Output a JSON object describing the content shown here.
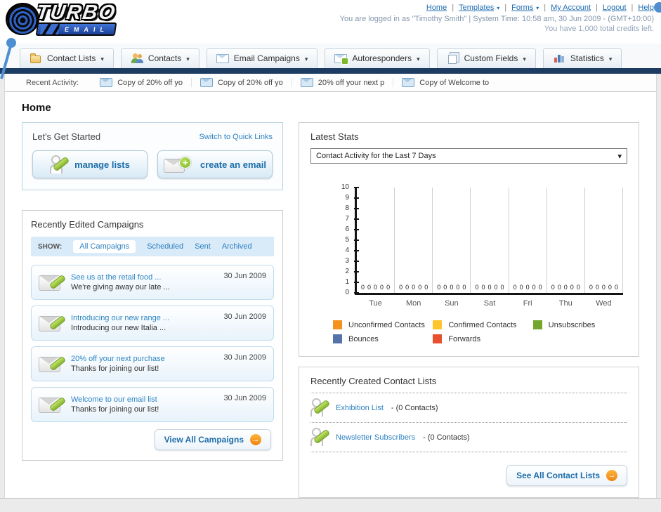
{
  "header": {
    "logo": {
      "line1": "TURBO",
      "line2": "EMAIL"
    },
    "nav_links": [
      {
        "label": "Home"
      },
      {
        "label": "Templates",
        "dropdown": true
      },
      {
        "label": "Forms",
        "dropdown": true
      },
      {
        "label": "My Account"
      },
      {
        "label": "Logout"
      },
      {
        "label": "Help"
      }
    ],
    "login_info": "You are logged in as \"Timothy Smith\" | System Time: 10:58 am, 30 Jun 2009 - (GMT+10:00)",
    "credits_info": "You have 1,000 total credits left."
  },
  "nav_tabs": [
    {
      "label": "Contact Lists"
    },
    {
      "label": "Contacts"
    },
    {
      "label": "Email Campaigns"
    },
    {
      "label": "Autoresponders"
    },
    {
      "label": "Custom Fields"
    },
    {
      "label": "Statistics"
    }
  ],
  "recent_activity": {
    "label": "Recent Activity:",
    "items": [
      "Copy of 20% off yo",
      "Copy of 20% off yo",
      "20% off your next p",
      "Copy of Welcome to"
    ]
  },
  "page_title": "Home",
  "get_started": {
    "title": "Let's Get Started",
    "switch_link": "Switch to Quick Links",
    "buttons": [
      {
        "label": "manage lists"
      },
      {
        "label": "create an email"
      }
    ]
  },
  "campaigns": {
    "title": "Recently Edited Campaigns",
    "show_label": "SHOW:",
    "filters": [
      {
        "label": "All Campaigns",
        "active": true
      },
      {
        "label": "Scheduled"
      },
      {
        "label": "Sent"
      },
      {
        "label": "Archived"
      }
    ],
    "items": [
      {
        "title": "See us at the retail food ...",
        "subtitle": "We're giving away our late ...",
        "date": "30 Jun 2009"
      },
      {
        "title": "Introducing our new range ...",
        "subtitle": "Introducing our new Italia ...",
        "date": "30 Jun 2009"
      },
      {
        "title": "20% off your next purchase",
        "subtitle": "Thanks for joining our list!",
        "date": "30 Jun 2009"
      },
      {
        "title": "Welcome to our email list",
        "subtitle": "Thanks for joining our list!",
        "date": "30 Jun 2009"
      }
    ],
    "view_all": "View All Campaigns"
  },
  "stats": {
    "title": "Latest Stats",
    "dropdown_value": "Contact Activity for the Last 7 Days"
  },
  "chart_data": {
    "type": "bar",
    "title": "Contact Activity for the Last 7 Days",
    "categories": [
      "Tue",
      "Mon",
      "Sun",
      "Sat",
      "Fri",
      "Thu",
      "Wed"
    ],
    "series": [
      {
        "name": "Unconfirmed Contacts",
        "color": "#f5921e",
        "values": [
          0,
          0,
          0,
          0,
          0,
          0,
          0
        ]
      },
      {
        "name": "Confirmed Contacts",
        "color": "#fdc62d",
        "values": [
          0,
          0,
          0,
          0,
          0,
          0,
          0
        ]
      },
      {
        "name": "Unsubscribes",
        "color": "#74a62c",
        "values": [
          0,
          0,
          0,
          0,
          0,
          0,
          0
        ]
      },
      {
        "name": "Bounces",
        "color": "#5573a8",
        "values": [
          0,
          0,
          0,
          0,
          0,
          0,
          0
        ]
      },
      {
        "name": "Forwards",
        "color": "#e8502e",
        "values": [
          0,
          0,
          0,
          0,
          0,
          0,
          0
        ]
      }
    ],
    "xlabel": "",
    "ylabel": "",
    "ylim": [
      0,
      10
    ],
    "ytick_step": 1,
    "grid": "vertical",
    "legend_position": "bottom"
  },
  "contact_lists": {
    "title": "Recently Created Contact Lists",
    "items": [
      {
        "name": "Exhibition List",
        "detail": "- (0 Contacts)"
      },
      {
        "name": "Newsletter Subscribers",
        "detail": "- (0 Contacts)"
      }
    ],
    "see_all": "See All Contact Lists"
  }
}
